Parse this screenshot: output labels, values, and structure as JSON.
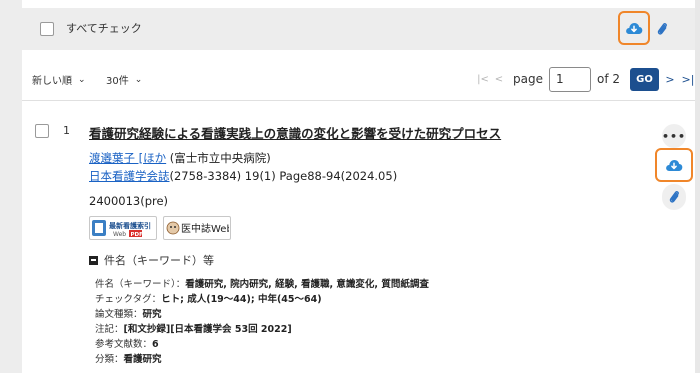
{
  "toolbar_top": {
    "check_all_label": "すべてチェック",
    "download_icon": "cloud-download-icon",
    "attach_icon": "paperclip-icon"
  },
  "list_controls": {
    "sort_value": "新しい順",
    "per_page_value": "30件",
    "page_label": "page",
    "current_page": "1",
    "of_label": "of 2",
    "go_label": "GO"
  },
  "record": {
    "number": "1",
    "title": "看護研究経験による看護実践上の意識の変化と影響を受けた研究プロセス",
    "authors_link": "渡邉葉子 [ほか",
    "authors_rest": " (富士市立中央病院)",
    "journal_link": "日本看護学会誌",
    "journal_rest": "(2758-3384) 19(1) Page88-94(2024.05)",
    "doc_id": "2400013(pre)",
    "badge1_label": "最新看護索引 Web PDF",
    "badge2_label": "医中誌Web",
    "keywords_heading": "件名（キーワード）等",
    "fields": [
      {
        "label": "件名（キーワード）：",
        "value": "看護研究, 院内研究, 経験, 看護職, 意識変化, 質問紙調査"
      },
      {
        "label": "チェックタグ：",
        "value": "ヒト; 成人(19〜44); 中年(45〜64)"
      },
      {
        "label": "論文種類：",
        "value": "研究"
      },
      {
        "label": "注記：",
        "value": "[和文抄録][日本看護学会 53回 2022]"
      },
      {
        "label": "参考文献数：",
        "value": "6"
      },
      {
        "label": "分類：",
        "value": "看護研究"
      }
    ],
    "more_label": "•••"
  },
  "colors": {
    "accent_orange": "#f0862a",
    "link_blue": "#1a62c4",
    "go_button": "#1c4f8f",
    "icon_blue": "#2d8ad6"
  }
}
